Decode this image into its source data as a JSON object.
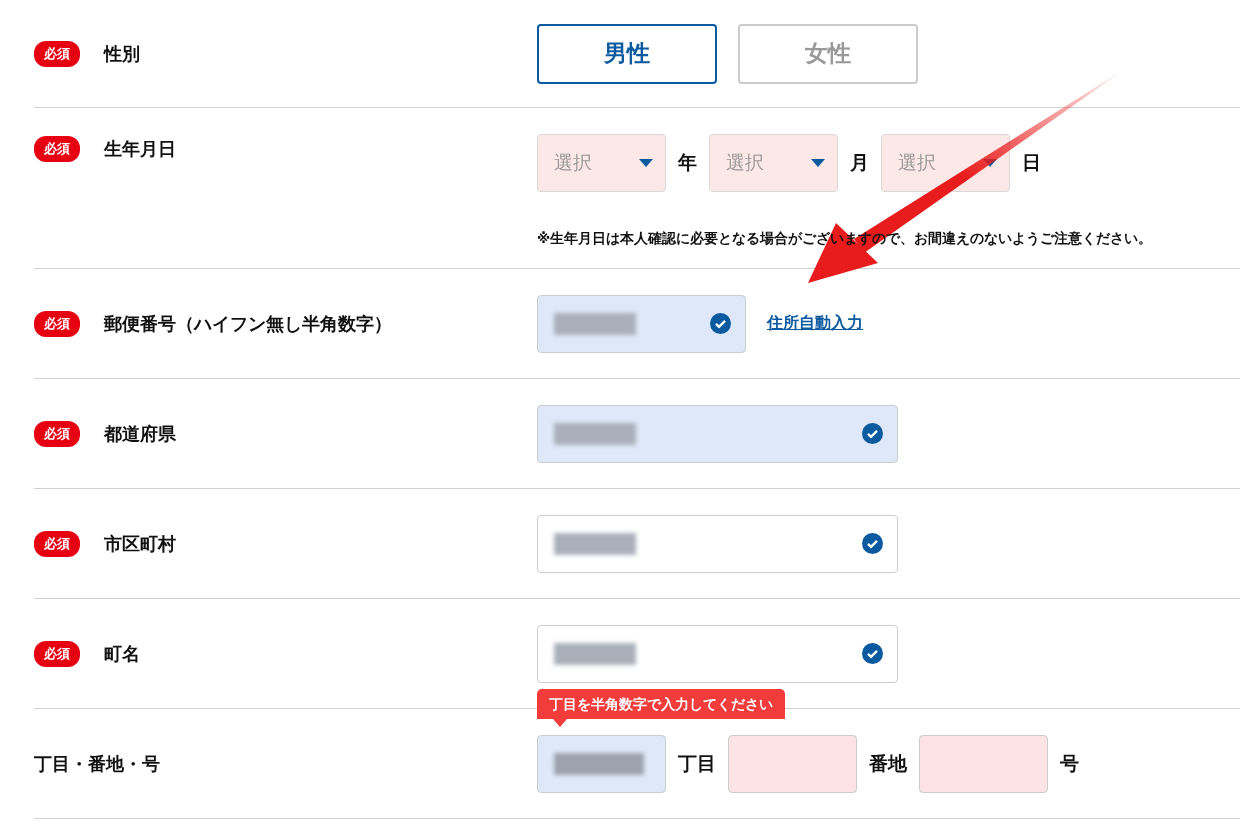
{
  "rows": [
    {
      "kind": "gender",
      "badge": "必須",
      "label": "性別",
      "options": [
        {
          "label": "男性",
          "selected": true
        },
        {
          "label": "女性",
          "selected": false
        }
      ]
    },
    {
      "kind": "date",
      "badge": "必須",
      "label": "生年月日",
      "selects": [
        {
          "placeholder": "選択",
          "unit": "年"
        },
        {
          "placeholder": "選択",
          "unit": "月"
        },
        {
          "placeholder": "選択",
          "unit": "日"
        }
      ],
      "note": "※生年月日は本人確認に必要となる場合がございますので、お間違えのないようご注意ください。"
    },
    {
      "kind": "postal",
      "badge": "必須",
      "label": "郵便番号（ハイフン無し半角数字）",
      "autofilled": true,
      "redacted": true,
      "valid": true,
      "link": "住所自動入力"
    },
    {
      "kind": "text",
      "badge": "必須",
      "label": "都道府県",
      "autofilled": true,
      "redacted": true,
      "valid": true
    },
    {
      "kind": "text",
      "badge": "必須",
      "label": "市区町村",
      "autofilled": false,
      "redacted": true,
      "valid": true
    },
    {
      "kind": "text",
      "badge": "必須",
      "label": "町名",
      "autofilled": false,
      "redacted": true,
      "valid": true
    },
    {
      "kind": "address",
      "label": "丁目・番地・号",
      "parts": [
        {
          "unit": "丁目",
          "autofilled": true,
          "redacted": true,
          "error": false,
          "tooltip": "丁目を半角数字で入力してください"
        },
        {
          "unit": "番地",
          "autofilled": false,
          "error": true
        },
        {
          "unit": "号",
          "autofilled": false,
          "error": true
        }
      ]
    }
  ]
}
